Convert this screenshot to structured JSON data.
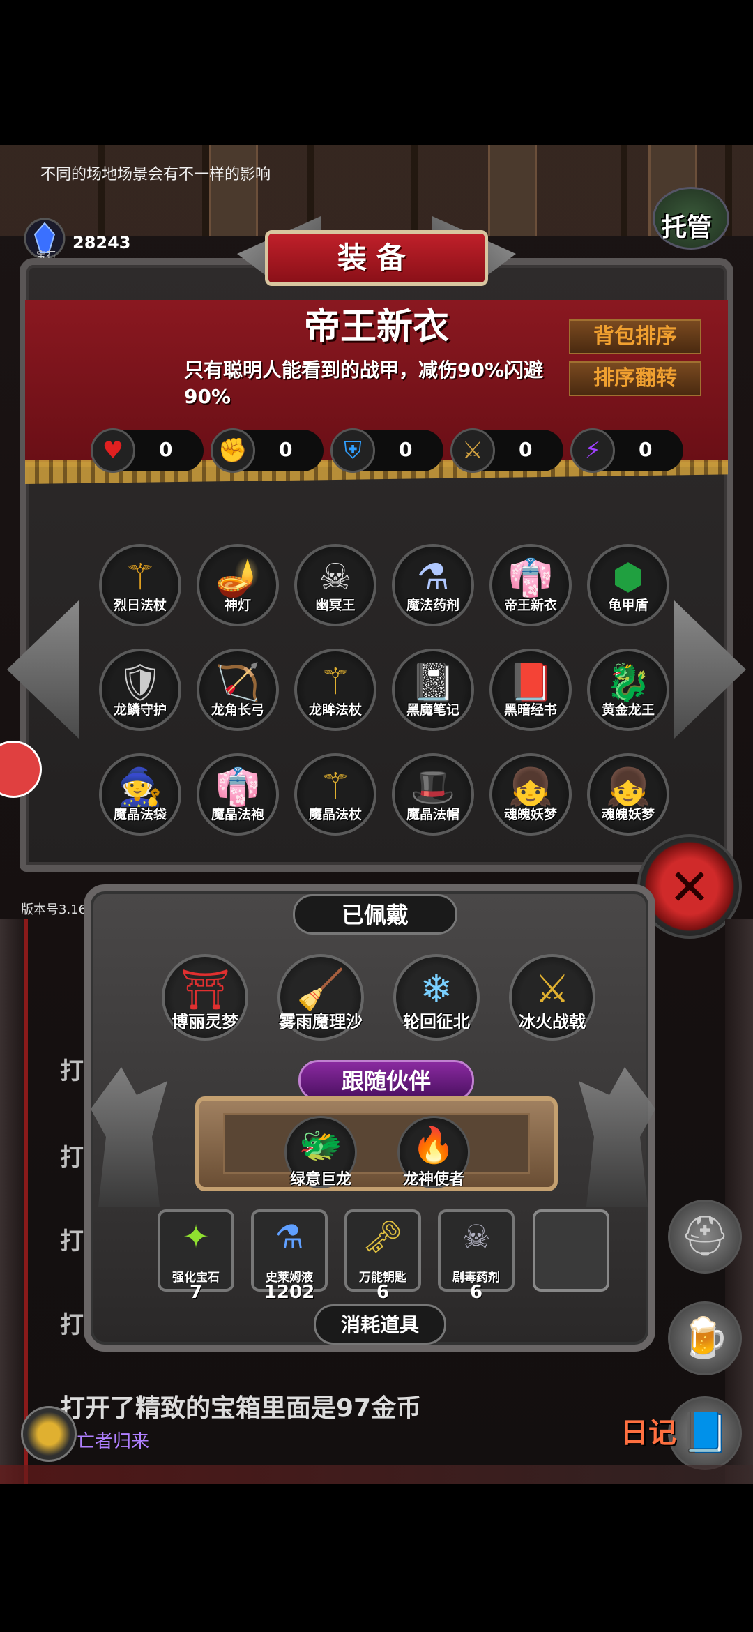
{
  "hint": "不同的场地场景会有不一样的影响",
  "gems": {
    "count": "28243",
    "label": "宝石"
  },
  "auto_label": "托管",
  "panel_title": "装备",
  "selected_item": {
    "name": "帝王新衣",
    "description": "只有聪明人能看到的战甲，减伤90%闪避90%"
  },
  "sort_buttons": {
    "sort": "背包排序",
    "flip": "排序翻转"
  },
  "stats": [
    {
      "icon": "heart-icon",
      "value": "0"
    },
    {
      "icon": "strength-icon",
      "value": "0"
    },
    {
      "icon": "armor-icon",
      "value": "0"
    },
    {
      "icon": "weapon-icon",
      "value": "0"
    },
    {
      "icon": "lightning-icon",
      "value": "0"
    }
  ],
  "equipment": [
    {
      "label": "烈日法杖",
      "icon": "staff-icon"
    },
    {
      "label": "神灯",
      "icon": "lamp-icon"
    },
    {
      "label": "幽冥王",
      "icon": "skeleton-king-icon"
    },
    {
      "label": "魔法药剂",
      "icon": "potion-icon"
    },
    {
      "label": "帝王新衣",
      "icon": "robe-icon"
    },
    {
      "label": "龟甲盾",
      "icon": "shell-shield-icon"
    },
    {
      "label": "龙鳞守护",
      "icon": "dragon-shield-icon"
    },
    {
      "label": "龙角长弓",
      "icon": "bow-icon"
    },
    {
      "label": "龙眸法杖",
      "icon": "staff-icon"
    },
    {
      "label": "黑魔笔记",
      "icon": "black-book-icon"
    },
    {
      "label": "黑暗经书",
      "icon": "red-book-icon"
    },
    {
      "label": "黄金龙王",
      "icon": "golden-dragon-icon"
    },
    {
      "label": "魔晶法袋",
      "icon": "wizard-icon"
    },
    {
      "label": "魔晶法袍",
      "icon": "robe-icon"
    },
    {
      "label": "魔晶法杖",
      "icon": "staff-icon"
    },
    {
      "label": "魔晶法帽",
      "icon": "wizard-hat-icon"
    },
    {
      "label": "魂魄妖梦",
      "icon": "girl-icon"
    },
    {
      "label": "魂魄妖梦",
      "icon": "girl-icon"
    }
  ],
  "version": "版本号3.16",
  "worn_title": "已佩戴",
  "worn": [
    {
      "label": "博丽灵梦",
      "icon": "shrine-maiden-icon"
    },
    {
      "label": "雾雨魔理沙",
      "icon": "witch-icon"
    },
    {
      "label": "轮回征北",
      "icon": "ice-mace-icon"
    },
    {
      "label": "冰火战戟",
      "icon": "halberd-icon"
    }
  ],
  "follow_title": "跟随伙伴",
  "companions": [
    {
      "label": "绿意巨龙",
      "icon": "green-dragon-icon"
    },
    {
      "label": "龙神使者",
      "icon": "fire-dragon-icon"
    }
  ],
  "consumables_title": "消耗道具",
  "consumables": [
    {
      "label": "强化宝石",
      "count": "7",
      "icon": "gem-icon"
    },
    {
      "label": "史莱姆液",
      "count": "1202",
      "icon": "flask-icon"
    },
    {
      "label": "万能钥匙",
      "count": "6",
      "icon": "key-icon"
    },
    {
      "label": "剧毒药剂",
      "count": "6",
      "icon": "poison-icon"
    }
  ],
  "log": {
    "lines": [
      "打",
      "打开",
      "打",
      "打"
    ],
    "main": "打开了精致的宝箱里面是97金币",
    "tag": "亡者归来",
    "diary": "日记"
  },
  "colors": {
    "accent_red": "#c0202a",
    "gold": "#f0a030",
    "purple": "#8a2aa0"
  }
}
